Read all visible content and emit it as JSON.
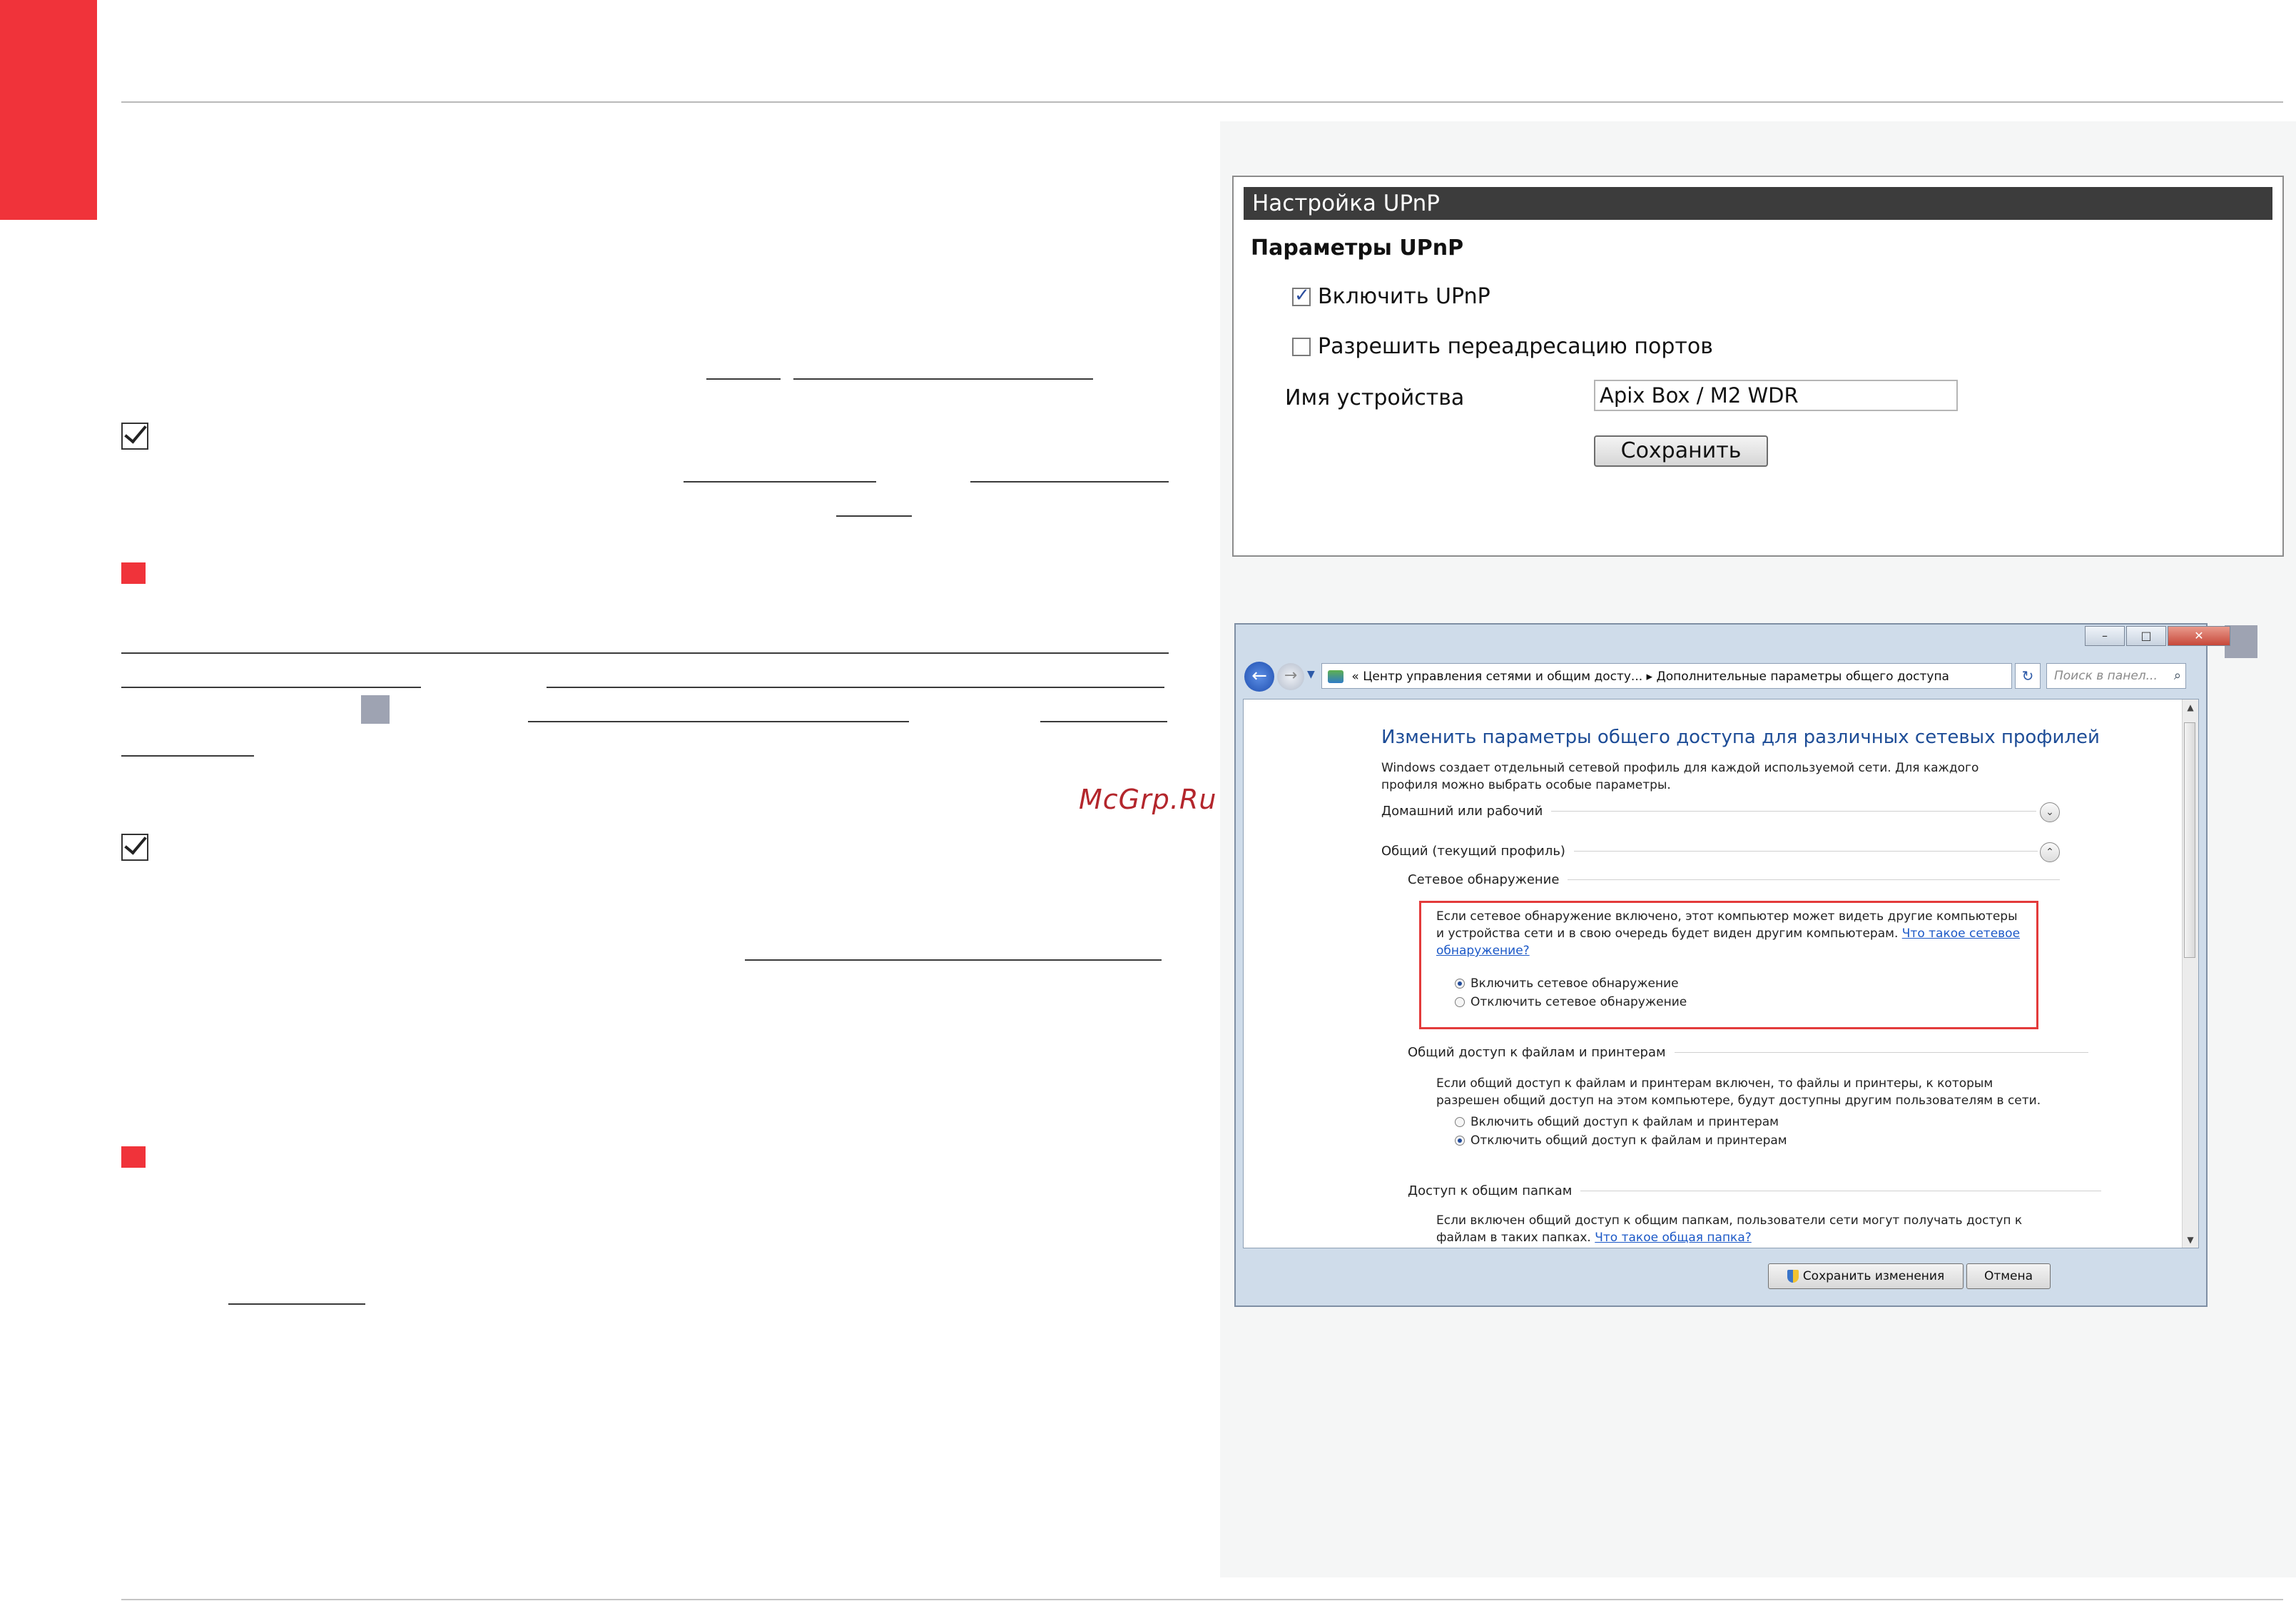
{
  "watermark": "McGrp.Ru",
  "upnp": {
    "title": "Настройка UPnP",
    "subtitle": "Параметры UPnP",
    "enable_label": "Включить UPnP",
    "enable_checked": true,
    "port_forward_label": "Разрешить переадресацию портов",
    "port_forward_checked": false,
    "device_name_label": "Имя устройства",
    "device_name_value": "Apix Box / M2 WDR",
    "save_label": "Сохранить"
  },
  "dialog": {
    "breadcrumb": "Центр управления сетями и общим досту...  ▸  Дополнительные параметры общего доступа",
    "breadcrumb_prefix": "«",
    "search_placeholder": "Поиск в панел...",
    "title": "Изменить параметры общего доступа для различных сетевых профилей",
    "description": "Windows создает отдельный сетевой профиль для каждой используемой сети. Для каждого профиля можно выбрать особые параметры.",
    "profile_home": "Домашний или рабочий",
    "profile_public": "Общий (текущий профиль)",
    "network_discovery": {
      "heading": "Сетевое обнаружение",
      "text": "Если сетевое обнаружение включено, этот компьютер может видеть другие компьютеры и устройства сети и в свою очередь будет виден другим компьютерам.",
      "link": "Что такое сетевое обнаружение?",
      "option_on": "Включить сетевое обнаружение",
      "option_off": "Отключить сетевое обнаружение",
      "selected": "on"
    },
    "file_sharing": {
      "heading": "Общий доступ к файлам и принтерам",
      "text": "Если общий доступ к файлам и принтерам включен, то файлы и принтеры, к которым разрешен общий доступ на этом компьютере, будут доступны другим пользователям в сети.",
      "option_on": "Включить общий доступ к файлам и принтерам",
      "option_off": "Отключить общий доступ к файлам и принтерам",
      "selected": "off"
    },
    "public_folders": {
      "heading": "Доступ к общим папкам",
      "text": "Если включен общий доступ к общим папкам, пользователи сети могут получать доступ к файлам в таких папках.",
      "link": "Что такое общая папка?"
    },
    "save_changes_label": "Сохранить изменения",
    "cancel_label": "Отмена"
  }
}
